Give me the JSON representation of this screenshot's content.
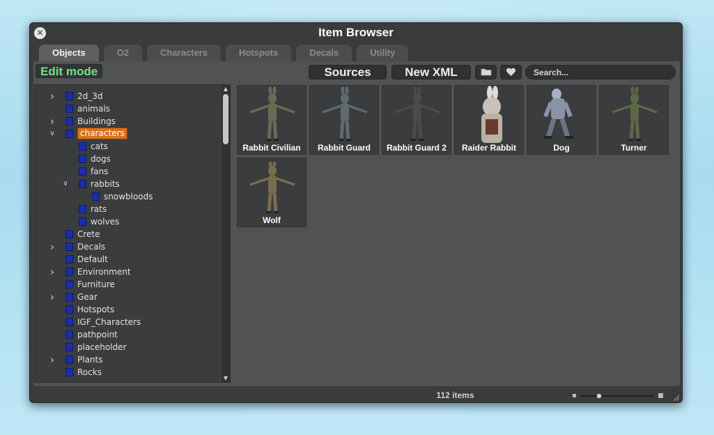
{
  "window": {
    "title": "Item Browser",
    "close_icon": "close-icon"
  },
  "tabs": [
    {
      "label": "Objects",
      "active": true
    },
    {
      "label": "O2",
      "active": false
    },
    {
      "label": "Characters",
      "active": false
    },
    {
      "label": "Hotspots",
      "active": false
    },
    {
      "label": "Decals",
      "active": false
    },
    {
      "label": "Utility",
      "active": false
    }
  ],
  "toolbar": {
    "edit_mode_label": "Edit mode",
    "sources_label": "Sources",
    "new_xml_label": "New XML",
    "folder_icon": "folder-icon",
    "heart_icon": "heart-icon",
    "search_placeholder": "Search..."
  },
  "tree": {
    "items": [
      {
        "label": "2d_3d",
        "depth": 0,
        "expander": "collapsed"
      },
      {
        "label": "animals",
        "depth": 0,
        "expander": "none"
      },
      {
        "label": "Buildings",
        "depth": 0,
        "expander": "collapsed"
      },
      {
        "label": "characters",
        "depth": 0,
        "expander": "expanded",
        "selected": true
      },
      {
        "label": "cats",
        "depth": 1,
        "expander": "none"
      },
      {
        "label": "dogs",
        "depth": 1,
        "expander": "none"
      },
      {
        "label": "fans",
        "depth": 1,
        "expander": "none"
      },
      {
        "label": "rabbits",
        "depth": 1,
        "expander": "expanded"
      },
      {
        "label": "snowbloods",
        "depth": 2,
        "expander": "none"
      },
      {
        "label": "rats",
        "depth": 1,
        "expander": "none"
      },
      {
        "label": "wolves",
        "depth": 1,
        "expander": "none"
      },
      {
        "label": "Crete",
        "depth": 0,
        "expander": "none"
      },
      {
        "label": "Decals",
        "depth": 0,
        "expander": "collapsed"
      },
      {
        "label": "Default",
        "depth": 0,
        "expander": "none"
      },
      {
        "label": "Environment",
        "depth": 0,
        "expander": "collapsed"
      },
      {
        "label": "Furniture",
        "depth": 0,
        "expander": "none"
      },
      {
        "label": "Gear",
        "depth": 0,
        "expander": "collapsed"
      },
      {
        "label": "Hotspots",
        "depth": 0,
        "expander": "none"
      },
      {
        "label": "IGF_Characters",
        "depth": 0,
        "expander": "none"
      },
      {
        "label": "pathpoint",
        "depth": 0,
        "expander": "none"
      },
      {
        "label": "placeholder",
        "depth": 0,
        "expander": "none"
      },
      {
        "label": "Plants",
        "depth": 0,
        "expander": "collapsed"
      },
      {
        "label": "Rocks",
        "depth": 0,
        "expander": "none"
      }
    ]
  },
  "items": [
    {
      "label": "Rabbit Civilian",
      "icon": "rabbit-civilian-thumbnail"
    },
    {
      "label": "Rabbit Guard",
      "icon": "rabbit-guard-thumbnail"
    },
    {
      "label": "Rabbit Guard 2",
      "icon": "rabbit-guard-2-thumbnail"
    },
    {
      "label": "Raider Rabbit",
      "icon": "raider-rabbit-thumbnail"
    },
    {
      "label": "Dog",
      "icon": "dog-thumbnail"
    },
    {
      "label": "Turner",
      "icon": "turner-thumbnail"
    },
    {
      "label": "Wolf",
      "icon": "wolf-thumbnail"
    }
  ],
  "status": {
    "item_count": "112 items",
    "zoom_level": 0.25
  },
  "colors": {
    "edit_mode": "#6fe38a",
    "selected": "#d7731f",
    "folder": "#1a2ea6"
  }
}
